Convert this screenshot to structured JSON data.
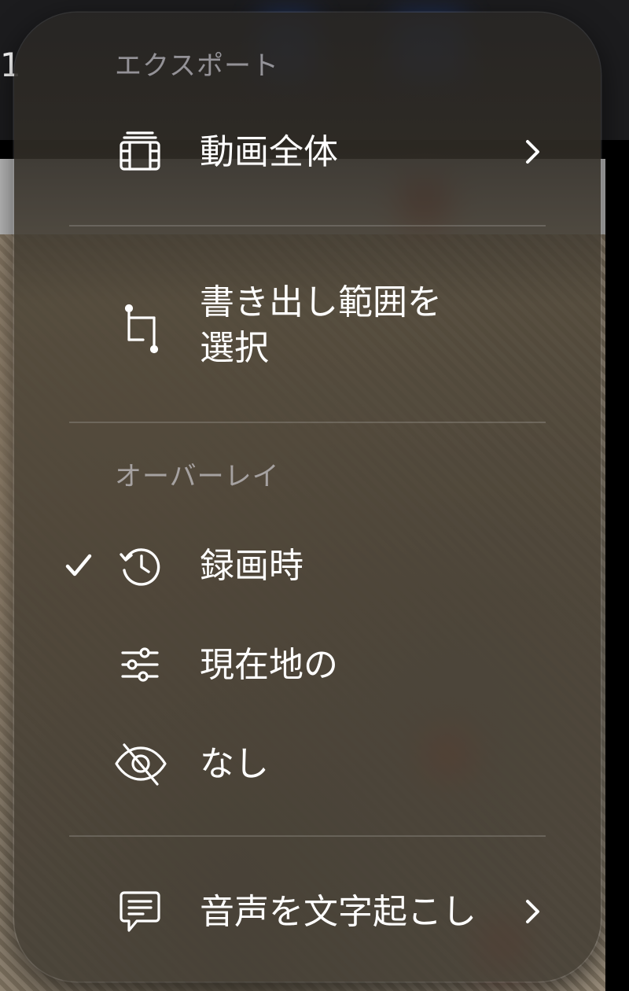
{
  "background": {
    "topbar_text": "1",
    "strip_text": "1"
  },
  "menu": {
    "export_header": "エクスポート",
    "overlay_header": "オーバーレイ",
    "items": [
      {
        "label": "動画全体",
        "icon": "film-icon",
        "has_submenu": true
      },
      {
        "label": "書き出し範囲を\n選択",
        "icon": "crop-icon",
        "has_submenu": false
      },
      {
        "label": "録画時",
        "icon": "history-icon",
        "checked": true
      },
      {
        "label": "現在地の",
        "icon": "sliders-icon",
        "checked": false
      },
      {
        "label": "なし",
        "icon": "eye-slash-icon",
        "checked": false
      },
      {
        "label": "音声を文字起こし",
        "icon": "chat-bubble-icon",
        "has_submenu": true
      }
    ]
  },
  "colors": {
    "text": "#ffffff",
    "header_text": "#9e9e9e",
    "accent_blue": "#1e3f8a"
  }
}
